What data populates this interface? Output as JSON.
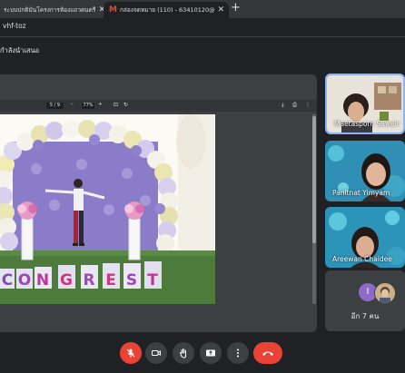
{
  "browser": {
    "tabs": [
      {
        "title": "ระบบปกติมันโครงการห้องแถวดนตรีวงเ",
        "close": "✕"
      },
      {
        "title": "กล่องจดหมาย (110) - 63410120@",
        "close": "✕"
      }
    ],
    "new_tab": "+",
    "address": "vhf-toz"
  },
  "presenter": {
    "label": "กำลังนำเสนอ"
  },
  "pdf_toolbar": {
    "page": "5 / 9",
    "zoom_minus": "–",
    "zoom": "77%",
    "zoom_plus": "+"
  },
  "banner": {
    "letters": [
      "C",
      "O",
      "N",
      "G",
      "R",
      "E",
      "S",
      "T"
    ]
  },
  "participants": [
    {
      "name": "Maetasporn Saweir"
    },
    {
      "name": "Panitnat Yimyam"
    },
    {
      "name": "Areewan Chaidee"
    }
  ],
  "more": {
    "avatar_letter": "I",
    "label": "อีก 7 คน"
  },
  "colors": {
    "accent": "#8ab4f8",
    "end_call": "#ea4335",
    "mute": "#ea4335"
  }
}
